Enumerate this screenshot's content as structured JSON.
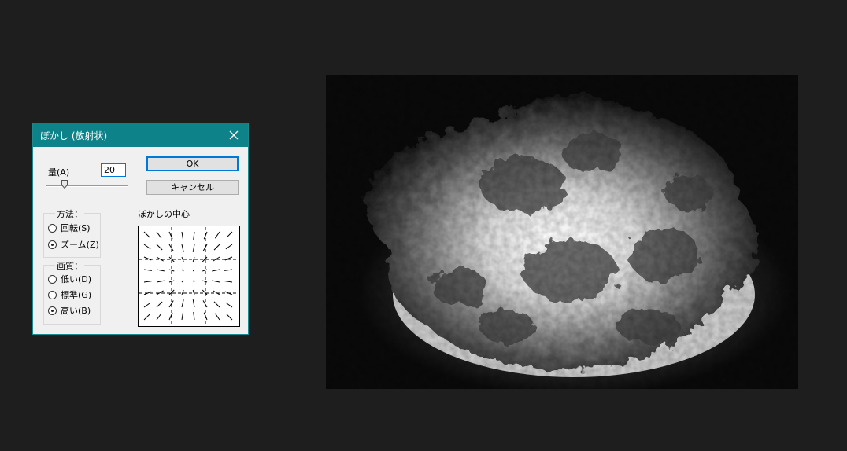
{
  "dialog": {
    "title": "ぼかし (放射状)",
    "amount_label": "量(A)",
    "amount_value": "20",
    "amount_fraction": 0.2,
    "ok_label": "OK",
    "cancel_label": "キャンセル",
    "method": {
      "legend": "方法：",
      "options": [
        {
          "label": "回転(S)",
          "selected": false
        },
        {
          "label": "ズーム(Z)",
          "selected": true
        }
      ]
    },
    "quality": {
      "legend": "画質：",
      "options": [
        {
          "label": "低い(D)",
          "selected": false
        },
        {
          "label": "標準(G)",
          "selected": false
        },
        {
          "label": "高い(B)",
          "selected": true
        }
      ]
    },
    "center_label": "ぼかしの中心"
  },
  "colors": {
    "background": "#1e1e1e",
    "titlebar": "#0d8389",
    "accent": "#0078d7"
  },
  "icons": {
    "close": "close-icon",
    "slider_thumb": "slider-thumb-icon"
  }
}
